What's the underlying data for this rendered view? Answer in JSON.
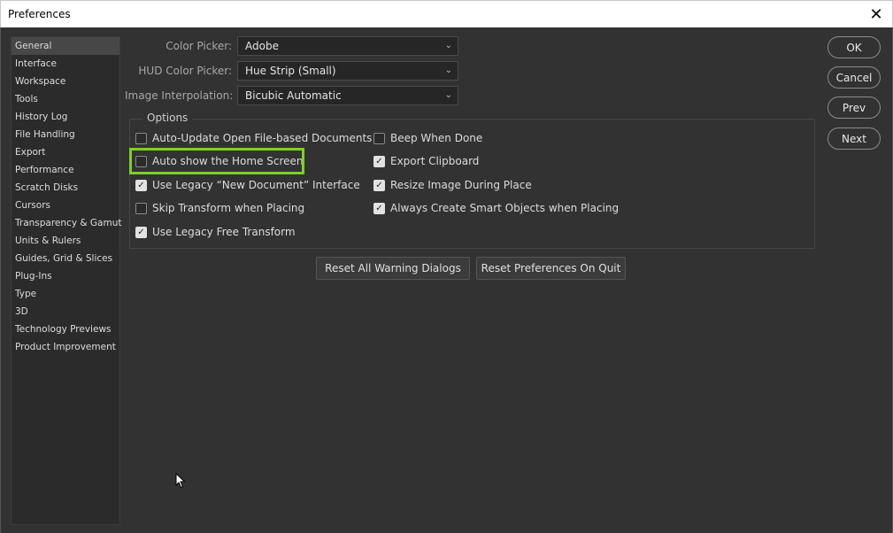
{
  "window": {
    "title": "Preferences",
    "close_glyph": "✕"
  },
  "sidebar": {
    "items": [
      {
        "label": "General"
      },
      {
        "label": "Interface"
      },
      {
        "label": "Workspace"
      },
      {
        "label": "Tools"
      },
      {
        "label": "History Log"
      },
      {
        "label": "File Handling"
      },
      {
        "label": "Export"
      },
      {
        "label": "Performance"
      },
      {
        "label": "Scratch Disks"
      },
      {
        "label": "Cursors"
      },
      {
        "label": "Transparency & Gamut"
      },
      {
        "label": "Units & Rulers"
      },
      {
        "label": "Guides, Grid & Slices"
      },
      {
        "label": "Plug-Ins"
      },
      {
        "label": "Type"
      },
      {
        "label": "3D"
      },
      {
        "label": "Technology Previews"
      },
      {
        "label": "Product Improvement"
      }
    ],
    "active_index": 0
  },
  "fields": {
    "color_picker": {
      "label": "Color Picker:",
      "value": "Adobe"
    },
    "hud_color_picker": {
      "label": "HUD Color Picker:",
      "value": "Hue Strip (Small)"
    },
    "image_interpolation": {
      "label": "Image Interpolation:",
      "value": "Bicubic Automatic"
    }
  },
  "options": {
    "title": "Options",
    "left": [
      {
        "label": "Auto-Update Open File-based Documents",
        "checked": false
      },
      {
        "label": "Auto show the Home Screen",
        "checked": false
      },
      {
        "label": "Use Legacy “New Document” Interface",
        "checked": true
      },
      {
        "label": "Skip Transform when Placing",
        "checked": false
      },
      {
        "label": "Use Legacy Free Transform",
        "checked": true
      }
    ],
    "right": [
      {
        "label": "Beep When Done",
        "checked": false
      },
      {
        "label": "Export Clipboard",
        "checked": true
      },
      {
        "label": "Resize Image During Place",
        "checked": true
      },
      {
        "label": "Always Create Smart Objects when Placing",
        "checked": true
      }
    ]
  },
  "buttons": {
    "reset_warnings": "Reset All Warning Dialogs",
    "reset_prefs": "Reset Preferences On Quit",
    "ok": "OK",
    "cancel": "Cancel",
    "prev": "Prev",
    "next": "Next"
  },
  "colors": {
    "background": "#323232",
    "highlight": "#7ecf2a"
  }
}
